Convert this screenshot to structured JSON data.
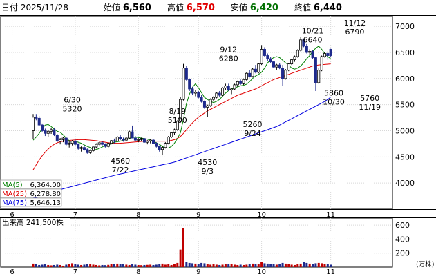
{
  "header": {
    "date_label": "日付 2025/11/28",
    "open_label": "始値",
    "open_value": "6,560",
    "high_label": "高値",
    "high_value": "6,570",
    "low_label": "安値",
    "low_value": "6,420",
    "close_label": "終値",
    "close_value": "6,440"
  },
  "colors": {
    "up": "#000000",
    "down": "#1e2a8c",
    "ma5": "#008000",
    "ma25": "#e00000",
    "ma75": "#0000e0",
    "high_value": "#e00000",
    "low_value": "#007000",
    "volume_up": "#c00000",
    "volume_down": "#1e2a8c"
  },
  "legend": [
    {
      "name": "MA(5)",
      "value": "6,364.00",
      "color": "#008000"
    },
    {
      "name": "MA(25)",
      "value": "6,278.80",
      "color": "#e00000"
    },
    {
      "name": "MA(75)",
      "value": "5,646.13",
      "color": "#0000e0"
    }
  ],
  "volume_label": "出来高  241,500株",
  "volume_unit": "(万株)",
  "chart_data": {
    "type": "candlestick",
    "price_ylim": [
      3500,
      7200
    ],
    "price_ticks": [
      4000,
      4500,
      5000,
      5500,
      6000,
      6500,
      7000
    ],
    "volume_ylim": [
      0,
      700
    ],
    "volume_ticks": [
      200,
      400,
      600
    ],
    "month_labels": [
      {
        "label": "6",
        "index": -7
      },
      {
        "label": "7",
        "index": 14
      },
      {
        "label": "8",
        "index": 35
      },
      {
        "label": "9",
        "index": 55
      },
      {
        "label": "10",
        "index": 76
      },
      {
        "label": "11",
        "index": 99
      }
    ],
    "annotations": [
      {
        "lines": [
          "6/30",
          "5320"
        ],
        "index": 13,
        "value": 5320,
        "pos": "above"
      },
      {
        "lines": [
          "4560",
          "7/22"
        ],
        "index": 29,
        "value": 4560,
        "pos": "below"
      },
      {
        "lines": [
          "8/19",
          "5100"
        ],
        "index": 48,
        "value": 5100,
        "pos": "above"
      },
      {
        "lines": [
          "4530",
          "9/3"
        ],
        "index": 58,
        "value": 4530,
        "pos": "below"
      },
      {
        "lines": [
          "9/12",
          "6280"
        ],
        "index": 65,
        "value": 6280,
        "pos": "above"
      },
      {
        "lines": [
          "5260",
          "9/24"
        ],
        "index": 73,
        "value": 5260,
        "pos": "below"
      },
      {
        "lines": [
          "10/21",
          "6640"
        ],
        "index": 93,
        "value": 6640,
        "pos": "above"
      },
      {
        "lines": [
          "5860",
          "10/30"
        ],
        "index": 100,
        "value": 5860,
        "pos": "below"
      },
      {
        "lines": [
          "11/12",
          "6790"
        ],
        "index": 107,
        "value": 6790,
        "pos": "above"
      },
      {
        "lines": [
          "5760",
          "11/19"
        ],
        "index": 112,
        "value": 5760,
        "pos": "below"
      }
    ],
    "ohlc": [
      [
        5000,
        5320,
        4840,
        5260
      ],
      [
        5260,
        5320,
        5200,
        5240
      ],
      [
        5240,
        5280,
        5090,
        5110
      ],
      [
        5110,
        5140,
        4980,
        5000
      ],
      [
        5000,
        5040,
        4900,
        4950
      ],
      [
        4950,
        5020,
        4880,
        4990
      ],
      [
        4990,
        5050,
        4940,
        5020
      ],
      [
        5020,
        5060,
        4900,
        4920
      ],
      [
        4920,
        4940,
        4780,
        4800
      ],
      [
        4800,
        4860,
        4740,
        4830
      ],
      [
        4830,
        4880,
        4780,
        4860
      ],
      [
        4860,
        4880,
        4720,
        4740
      ],
      [
        4740,
        4800,
        4680,
        4760
      ],
      [
        4760,
        4820,
        4720,
        4800
      ],
      [
        4800,
        4830,
        4720,
        4740
      ],
      [
        4740,
        4760,
        4640,
        4660
      ],
      [
        4660,
        4700,
        4600,
        4680
      ],
      [
        4680,
        4720,
        4620,
        4640
      ],
      [
        4640,
        4660,
        4560,
        4580
      ],
      [
        4580,
        4640,
        4560,
        4620
      ],
      [
        4620,
        4700,
        4600,
        4690
      ],
      [
        4690,
        4760,
        4660,
        4740
      ],
      [
        4740,
        4790,
        4700,
        4770
      ],
      [
        4770,
        4800,
        4720,
        4740
      ],
      [
        4740,
        4760,
        4680,
        4700
      ],
      [
        4700,
        4780,
        4680,
        4760
      ],
      [
        4760,
        4820,
        4740,
        4810
      ],
      [
        4810,
        4850,
        4760,
        4800
      ],
      [
        4800,
        4900,
        4790,
        4880
      ],
      [
        4880,
        4920,
        4820,
        4840
      ],
      [
        4840,
        4870,
        4790,
        4820
      ],
      [
        4820,
        4880,
        4800,
        4860
      ],
      [
        4860,
        5000,
        4850,
        4980
      ],
      [
        4980,
        5100,
        4940,
        4860
      ],
      [
        4860,
        4900,
        4800,
        4820
      ],
      [
        4820,
        4860,
        4780,
        4830
      ],
      [
        4830,
        4870,
        4800,
        4850
      ],
      [
        4850,
        4860,
        4770,
        4780
      ],
      [
        4780,
        4820,
        4740,
        4800
      ],
      [
        4800,
        4840,
        4760,
        4820
      ],
      [
        4820,
        4840,
        4750,
        4760
      ],
      [
        4760,
        4780,
        4680,
        4700
      ],
      [
        4700,
        4720,
        4600,
        4640
      ],
      [
        4640,
        4700,
        4530,
        4680
      ],
      [
        4680,
        4780,
        4660,
        4760
      ],
      [
        4760,
        4900,
        4740,
        4880
      ],
      [
        4880,
        4980,
        4860,
        4960
      ],
      [
        4960,
        5040,
        4920,
        5020
      ],
      [
        5020,
        5200,
        5000,
        5180
      ],
      [
        5180,
        5650,
        5160,
        5600
      ],
      [
        5600,
        6280,
        5580,
        6200
      ],
      [
        6200,
        6240,
        5960,
        5980
      ],
      [
        5980,
        6000,
        5760,
        5800
      ],
      [
        5800,
        5840,
        5680,
        5720
      ],
      [
        5720,
        5780,
        5660,
        5740
      ],
      [
        5740,
        5760,
        5620,
        5640
      ],
      [
        5640,
        5680,
        5540,
        5560
      ],
      [
        5560,
        5580,
        5420,
        5450
      ],
      [
        5450,
        5500,
        5260,
        5480
      ],
      [
        5480,
        5620,
        5460,
        5600
      ],
      [
        5600,
        5660,
        5560,
        5640
      ],
      [
        5640,
        5740,
        5620,
        5720
      ],
      [
        5720,
        5760,
        5640,
        5680
      ],
      [
        5680,
        5840,
        5660,
        5820
      ],
      [
        5820,
        5900,
        5780,
        5860
      ],
      [
        5860,
        5900,
        5760,
        5780
      ],
      [
        5780,
        5820,
        5700,
        5800
      ],
      [
        5800,
        5900,
        5780,
        5880
      ],
      [
        5880,
        5960,
        5840,
        5940
      ],
      [
        5940,
        5980,
        5880,
        5900
      ],
      [
        5900,
        6000,
        5880,
        5980
      ],
      [
        5980,
        6120,
        5960,
        6100
      ],
      [
        6100,
        6160,
        6020,
        6040
      ],
      [
        6040,
        6200,
        6020,
        6180
      ],
      [
        6180,
        6260,
        6100,
        6120
      ],
      [
        6120,
        6300,
        6100,
        6280
      ],
      [
        6280,
        6640,
        6260,
        6560
      ],
      [
        6560,
        6600,
        6420,
        6440
      ],
      [
        6440,
        6480,
        6340,
        6380
      ],
      [
        6380,
        6420,
        6300,
        6320
      ],
      [
        6320,
        6340,
        6200,
        6220
      ],
      [
        6220,
        6280,
        6160,
        6260
      ],
      [
        6260,
        6300,
        6180,
        6200
      ],
      [
        6200,
        6260,
        5860,
        6000
      ],
      [
        6000,
        6180,
        5980,
        6160
      ],
      [
        6160,
        6300,
        6140,
        6280
      ],
      [
        6280,
        6380,
        6260,
        6360
      ],
      [
        6360,
        6440,
        6320,
        6420
      ],
      [
        6420,
        6560,
        6400,
        6540
      ],
      [
        6540,
        6790,
        6520,
        6740
      ],
      [
        6740,
        6760,
        6600,
        6620
      ],
      [
        6620,
        6660,
        6480,
        6500
      ],
      [
        6500,
        6560,
        6460,
        6520
      ],
      [
        6520,
        6540,
        6380,
        6400
      ],
      [
        6400,
        6420,
        5760,
        5920
      ],
      [
        5920,
        6200,
        5900,
        6160
      ],
      [
        6160,
        6440,
        6140,
        6420
      ],
      [
        6420,
        6500,
        6400,
        6480
      ],
      [
        6480,
        6520,
        6360,
        6440
      ],
      [
        6560,
        6570,
        6420,
        6440
      ]
    ],
    "volume": [
      50,
      40,
      30,
      35,
      40,
      30,
      25,
      30,
      35,
      30,
      20,
      35,
      40,
      55,
      40,
      35,
      30,
      35,
      40,
      45,
      35,
      30,
      25,
      30,
      28,
      32,
      40,
      45,
      50,
      45,
      40,
      35,
      30,
      40,
      35,
      30,
      28,
      30,
      32,
      35,
      30,
      35,
      40,
      50,
      35,
      40,
      30,
      45,
      60,
      250,
      560,
      70,
      60,
      55,
      50,
      45,
      60,
      55,
      40,
      35,
      40,
      35,
      30,
      35,
      40,
      45,
      40,
      35,
      30,
      35,
      30,
      35,
      45,
      50,
      40,
      40,
      70,
      55,
      50,
      45,
      40,
      35,
      45,
      60,
      50,
      40,
      35,
      30,
      40,
      50,
      70,
      60,
      50,
      45,
      55,
      60,
      55,
      45,
      40,
      35
    ],
    "ma5": [
      4820,
      4880,
      4950,
      5040,
      5110,
      5120,
      5080,
      5030,
      4990,
      4970,
      4920,
      4860,
      4810,
      4790,
      4800,
      4780,
      4760,
      4730,
      4700,
      4680,
      4640,
      4640,
      4660,
      4690,
      4720,
      4730,
      4750,
      4780,
      4790,
      4800,
      4820,
      4830,
      4850,
      4870,
      4880,
      4870,
      4860,
      4850,
      4840,
      4820,
      4800,
      4770,
      4740,
      4700,
      4670,
      4670,
      4700,
      4760,
      4850,
      4960,
      5220,
      5520,
      5700,
      5830,
      5900,
      5820,
      5730,
      5640,
      5600,
      5560,
      5540,
      5560,
      5600,
      5660,
      5720,
      5770,
      5800,
      5820,
      5840,
      5860,
      5870,
      5890,
      5940,
      6000,
      6050,
      6080,
      6120,
      6200,
      6300,
      6360,
      6400,
      6420,
      6400,
      6350,
      6300,
      6260,
      6200,
      6180,
      6200,
      6240,
      6300,
      6380,
      6440,
      6520,
      6580,
      6620,
      6560,
      6480,
      6420,
      6380
    ],
    "ma25": [
      4250,
      4350,
      4440,
      4520,
      4590,
      4650,
      4700,
      4740,
      4770,
      4790,
      4800,
      4810,
      4815,
      4820,
      4825,
      4830,
      4830,
      4830,
      4825,
      4820,
      4815,
      4810,
      4800,
      4790,
      4780,
      4770,
      4765,
      4760,
      4760,
      4762,
      4765,
      4770,
      4775,
      4780,
      4785,
      4790,
      4795,
      4800,
      4805,
      4805,
      4800,
      4800,
      4800,
      4800,
      4800,
      4805,
      4815,
      4830,
      4855,
      4890,
      4950,
      5020,
      5090,
      5150,
      5210,
      5260,
      5300,
      5340,
      5380,
      5410,
      5440,
      5470,
      5500,
      5530,
      5560,
      5590,
      5620,
      5650,
      5680,
      5700,
      5720,
      5740,
      5760,
      5780,
      5800,
      5830,
      5860,
      5890,
      5920,
      5950,
      5980,
      6000,
      6020,
      6040,
      6060,
      6080,
      6100,
      6120,
      6140,
      6160,
      6180,
      6200,
      6220,
      6240,
      6250,
      6260,
      6265,
      6270,
      6275,
      6280
    ],
    "ma75": [
      3710,
      3720,
      3740,
      3760,
      3780,
      3800,
      3820,
      3840,
      3860,
      3875,
      3890,
      3905,
      3920,
      3935,
      3950,
      3965,
      3980,
      3995,
      4010,
      4025,
      4040,
      4055,
      4070,
      4085,
      4100,
      4115,
      4130,
      4145,
      4160,
      4172,
      4185,
      4198,
      4210,
      4222,
      4235,
      4248,
      4260,
      4272,
      4285,
      4298,
      4310,
      4322,
      4335,
      4348,
      4360,
      4372,
      4385,
      4400,
      4420,
      4440,
      4460,
      4480,
      4500,
      4520,
      4540,
      4560,
      4580,
      4600,
      4620,
      4640,
      4660,
      4680,
      4700,
      4720,
      4740,
      4760,
      4780,
      4800,
      4820,
      4840,
      4860,
      4880,
      4900,
      4920,
      4940,
      4960,
      4980,
      5000,
      5020,
      5040,
      5060,
      5080,
      5110,
      5140,
      5170,
      5200,
      5230,
      5260,
      5290,
      5320,
      5350,
      5380,
      5410,
      5440,
      5470,
      5500,
      5530,
      5560,
      5600,
      5646
    ]
  }
}
